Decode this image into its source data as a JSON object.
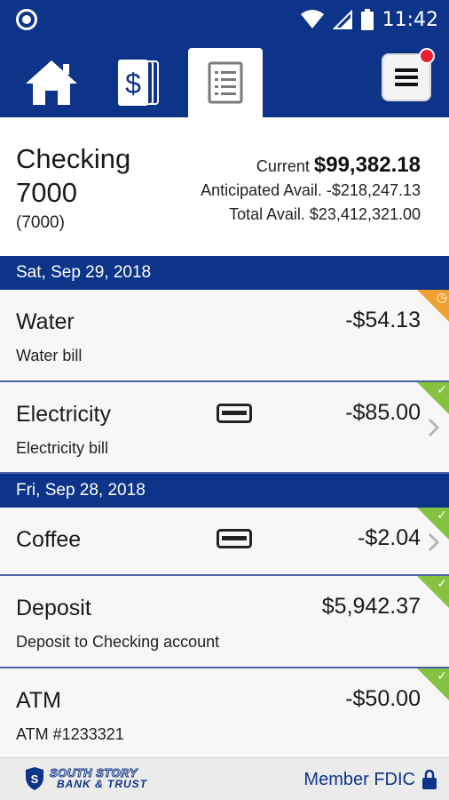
{
  "status_bar": {
    "time": "11:42"
  },
  "account": {
    "name": "Checking 7000",
    "number": "(7000)",
    "current_label": "Current",
    "current_value": "$99,382.18",
    "anticipated_label": "Anticipated Avail.",
    "anticipated_value": "-$218,247.13",
    "total_label": "Total Avail.",
    "total_value": "$23,412,321.00"
  },
  "groups": [
    {
      "date": "Sat, Sep 29, 2018",
      "transactions": [
        {
          "name": "Water",
          "description": "Water bill",
          "amount": "-$54.13",
          "status": "pending",
          "card": false,
          "chevron": false
        },
        {
          "name": "Electricity",
          "description": "Electricity bill",
          "amount": "-$85.00",
          "status": "cleared",
          "card": true,
          "chevron": true
        }
      ]
    },
    {
      "date": "Fri, Sep 28, 2018",
      "transactions": [
        {
          "name": "Coffee",
          "description": "",
          "amount": "-$2.04",
          "status": "cleared",
          "card": true,
          "chevron": true
        },
        {
          "name": "Deposit",
          "description": "Deposit to Checking account",
          "amount": "$5,942.37",
          "status": "cleared",
          "card": false,
          "chevron": false
        },
        {
          "name": "ATM",
          "description": "ATM #1233321",
          "amount": "-$50.00",
          "status": "cleared",
          "card": false,
          "chevron": false
        }
      ]
    }
  ],
  "footer": {
    "logo_line1": "SOUTH STORY",
    "logo_line2": "BANK & TRUST",
    "fdic_label": "Member FDIC"
  },
  "colors": {
    "brand": "#0d3488",
    "pending": "#f0a033",
    "cleared": "#85c241",
    "badge": "#e5202e"
  },
  "icons": {
    "home": "home-icon",
    "accounts": "dollar-cards-icon",
    "statements": "document-list-icon",
    "menu": "hamburger-menu-icon",
    "card": "credit-card-icon",
    "chevron": "chevron-right-icon",
    "lock": "lock-icon"
  }
}
